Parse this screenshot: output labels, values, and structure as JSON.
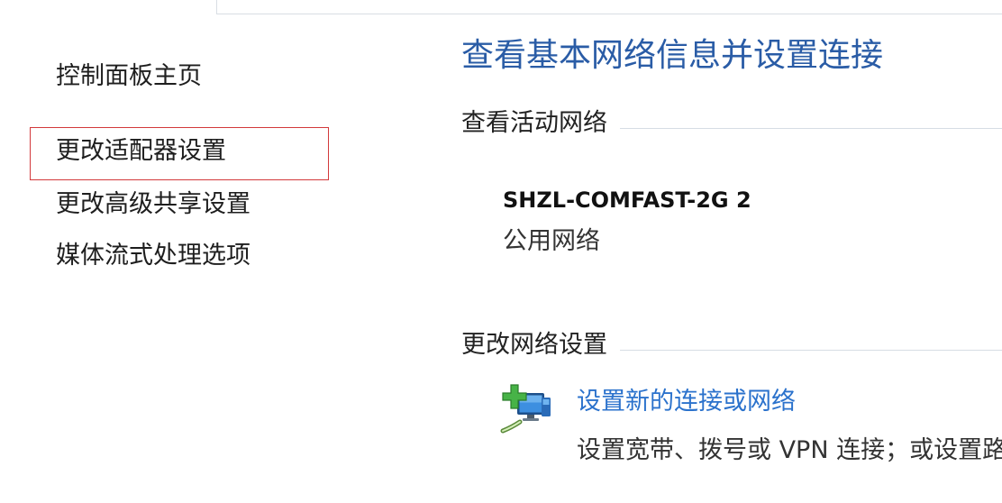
{
  "sidebar": {
    "items": [
      {
        "label": "控制面板主页"
      },
      {
        "label": "更改适配器设置",
        "highlighted": true
      },
      {
        "label": "更改高级共享设置"
      },
      {
        "label": "媒体流式处理选项"
      }
    ]
  },
  "main": {
    "title": "查看基本网络信息并设置连接",
    "active_networks": {
      "section_label": "查看活动网络",
      "network_name": "SHZL-COMFAST-2G 2",
      "network_type": "公用网络"
    },
    "change_settings": {
      "section_label": "更改网络设置",
      "tasks": [
        {
          "icon": "network-add-icon",
          "link": "设置新的连接或网络",
          "description": "设置宽带、拨号或 VPN 连接；或设置路"
        }
      ]
    }
  },
  "colors": {
    "title": "#2a5ca6",
    "link": "#2b72cc",
    "highlight": "#d3393b",
    "divider": "#d6dde4",
    "text": "#1e1e1e"
  }
}
